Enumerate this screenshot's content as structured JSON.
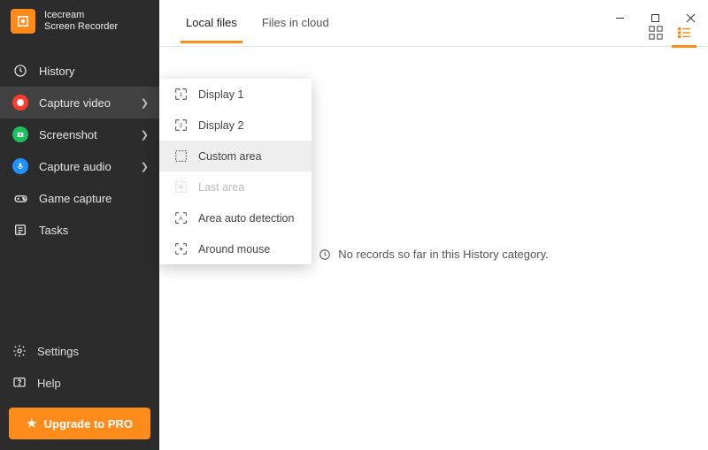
{
  "app": {
    "name": "Icecream",
    "subtitle": "Screen Recorder"
  },
  "sidebar": {
    "items": [
      {
        "label": "History"
      },
      {
        "label": "Capture video"
      },
      {
        "label": "Screenshot"
      },
      {
        "label": "Capture audio"
      },
      {
        "label": "Game capture"
      },
      {
        "label": "Tasks"
      }
    ],
    "settings": "Settings",
    "help": "Help",
    "upgrade": "Upgrade to PRO"
  },
  "tabs": {
    "local": "Local files",
    "cloud": "Files in cloud"
  },
  "submenu": {
    "display1": "Display 1",
    "display2": "Display 2",
    "custom_area": "Custom area",
    "last_area": "Last area",
    "auto_detect": "Area auto detection",
    "around_mouse": "Around mouse"
  },
  "empty_state": "No records so far in this History category.",
  "colors": {
    "accent": "#ff8b1a",
    "sidebar_bg": "#2c2c2c"
  }
}
